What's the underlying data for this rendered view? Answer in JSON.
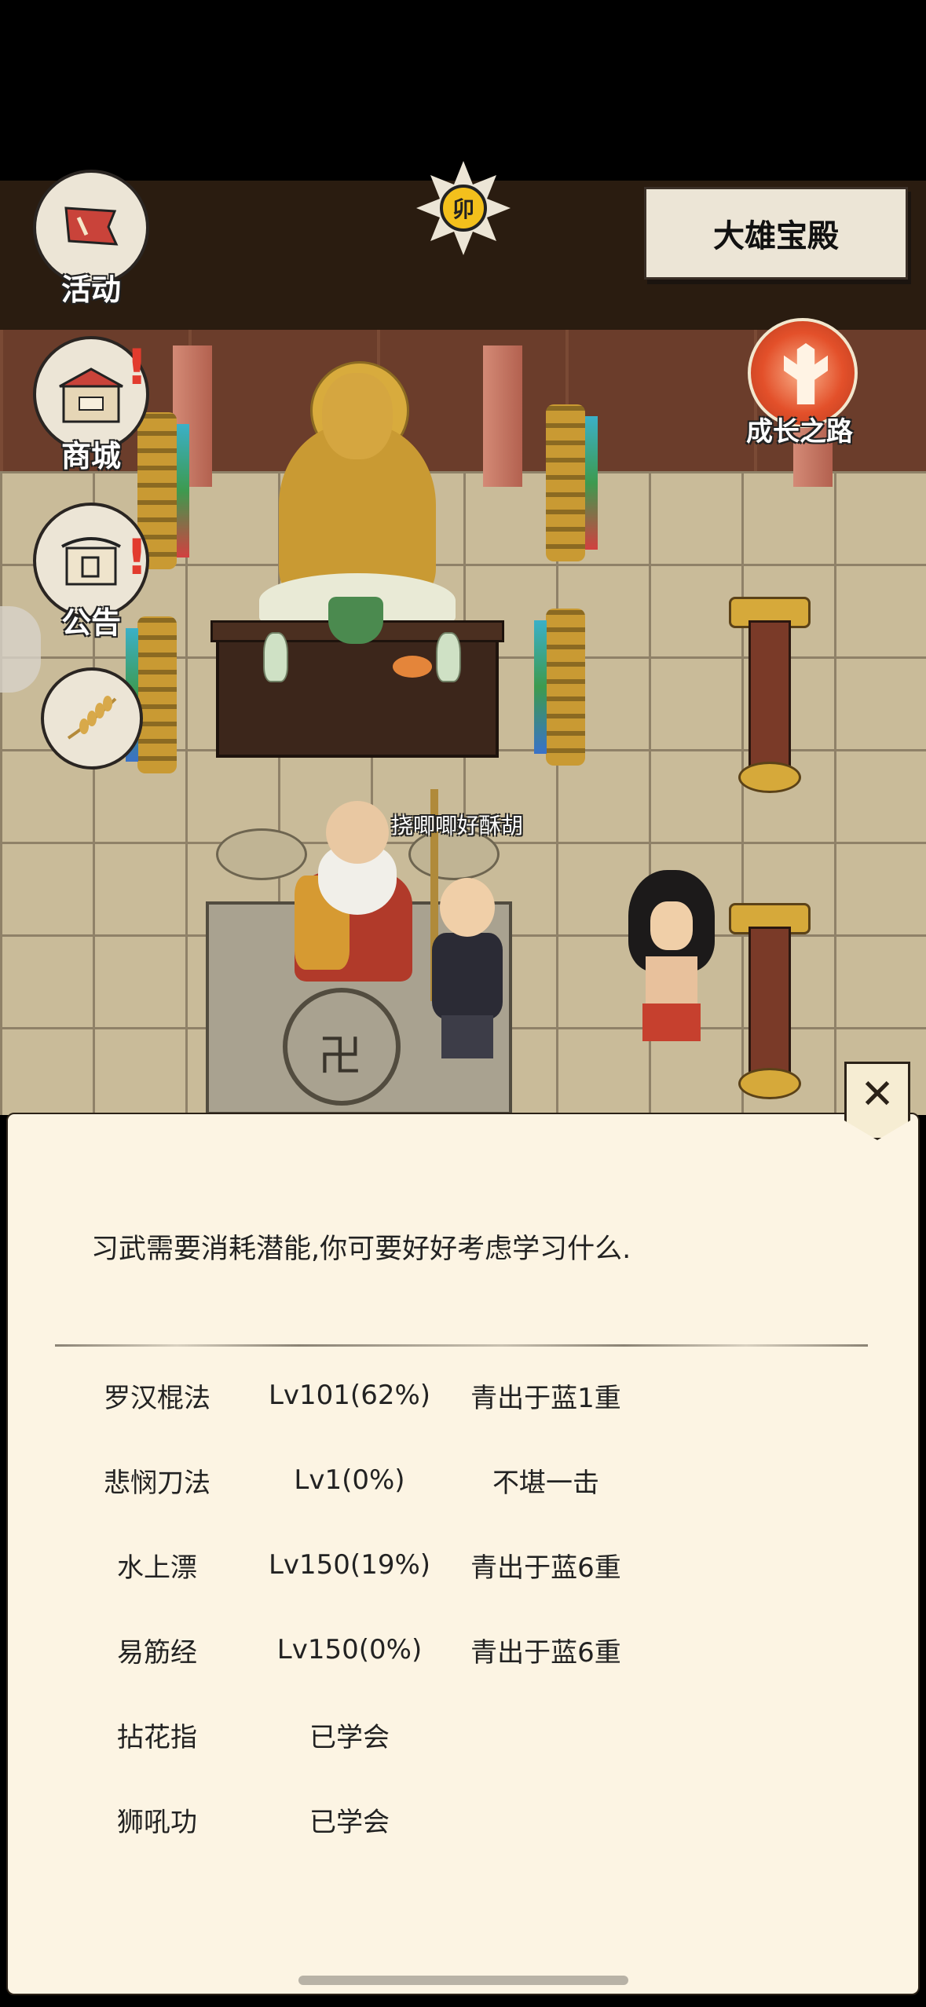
{
  "location": {
    "name": "大雄宝殿"
  },
  "time_badge": {
    "label": "卯"
  },
  "side_menu": {
    "items": [
      {
        "label": "活动",
        "icon": "banner-flag-icon",
        "alert": false
      },
      {
        "label": "商城",
        "icon": "shop-stall-icon",
        "alert": true
      },
      {
        "label": "公告",
        "icon": "notice-board-icon",
        "alert": true
      },
      {
        "label": "",
        "icon": "wheat-icon",
        "alert": false
      }
    ]
  },
  "growth": {
    "label": "成长之路",
    "icon": "cheering-figure-icon"
  },
  "scene": {
    "npc_name_tag": "挠唧唧好酥胡"
  },
  "dialog": {
    "message": "习武需要消耗潜能,你可要好好考虑学习什么.",
    "close_icon": "close-icon",
    "skills": [
      {
        "name": "罗汉棍法",
        "level": "Lv101(62%)",
        "rank": "青出于蓝1重"
      },
      {
        "name": "悲悯刀法",
        "level": "Lv1(0%)",
        "rank": "不堪一击"
      },
      {
        "name": "水上漂",
        "level": "Lv150(19%)",
        "rank": "青出于蓝6重"
      },
      {
        "name": "易筋经",
        "level": "Lv150(0%)",
        "rank": "青出于蓝6重"
      },
      {
        "name": "拈花指",
        "level": "已学会",
        "rank": ""
      },
      {
        "name": "狮吼功",
        "level": "已学会",
        "rank": ""
      }
    ]
  },
  "colors": {
    "panel_bg": "#fcf4e3",
    "floor": "#c9bb99",
    "alert_red": "#e23b2e",
    "time_gold": "#f3c01c"
  }
}
